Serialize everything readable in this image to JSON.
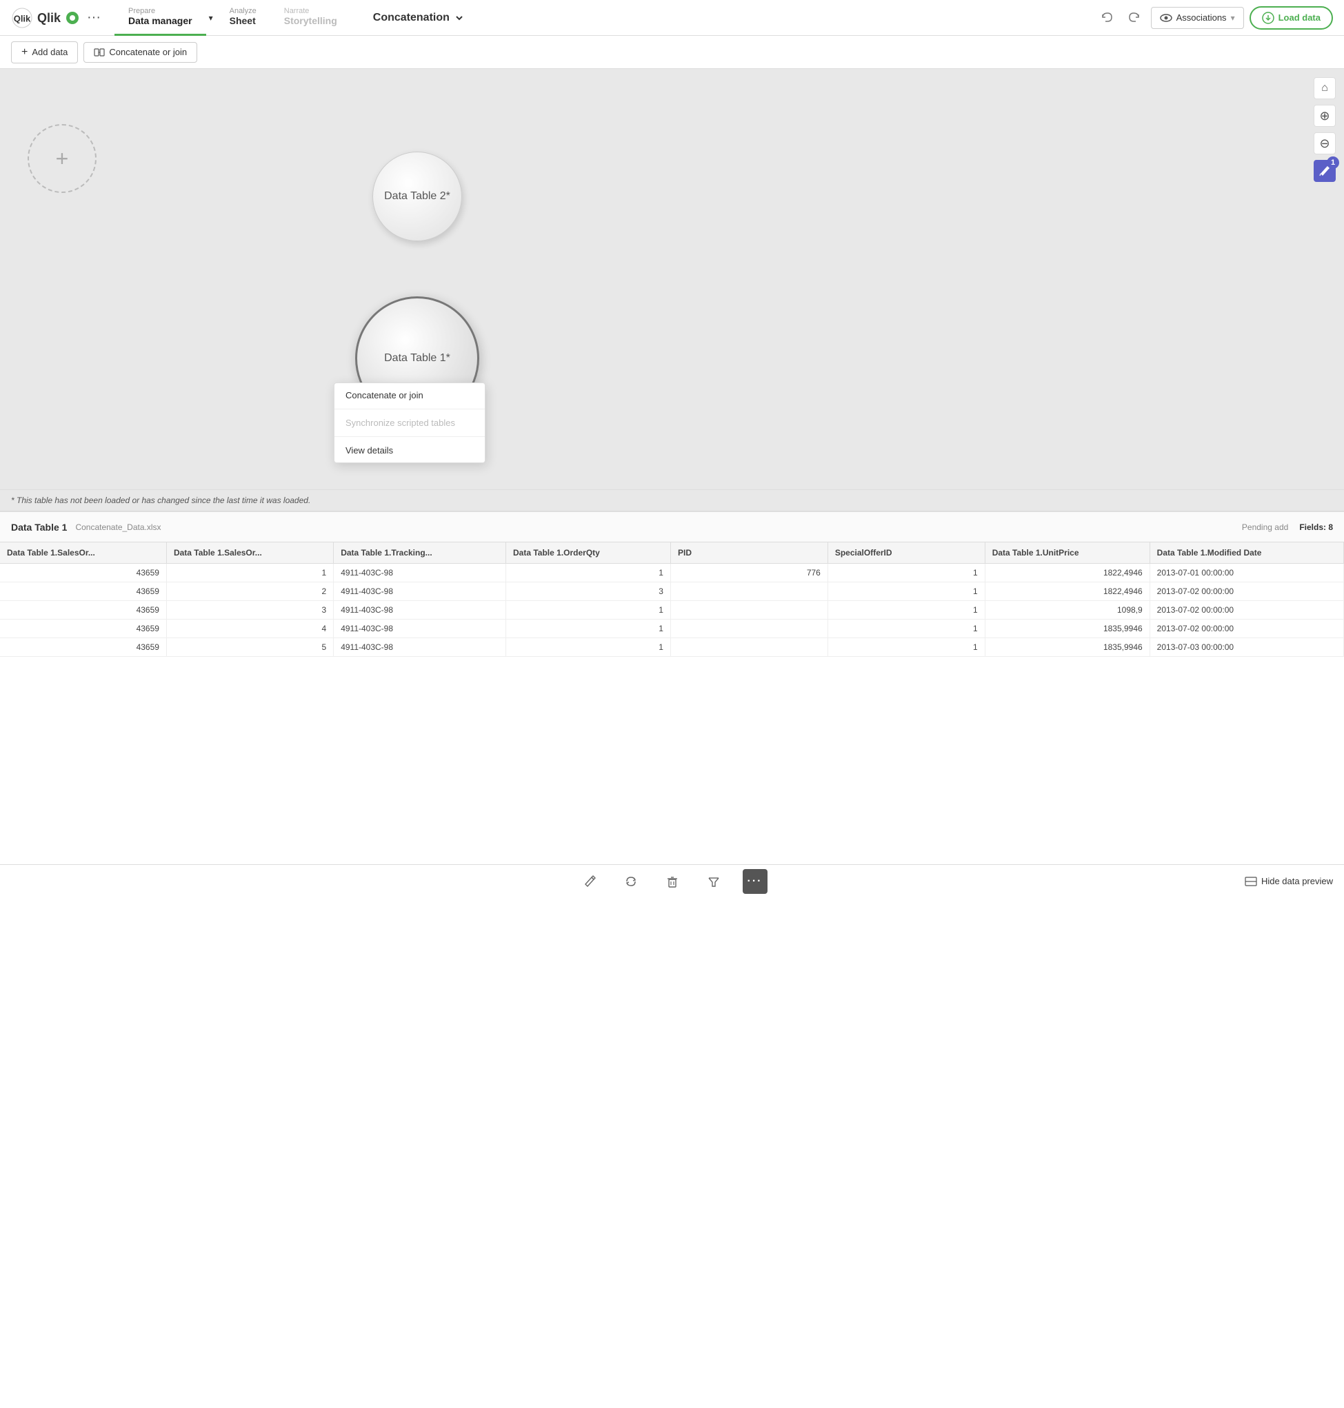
{
  "app": {
    "logo_text": "Qlik",
    "more_label": "···"
  },
  "nav": {
    "prepare_sub": "Prepare",
    "prepare_main": "Data manager",
    "analyze_sub": "Analyze",
    "analyze_main": "Sheet",
    "narrate_sub": "Narrate",
    "narrate_main": "Storytelling",
    "dropdown_label": "Concatenation",
    "associations_label": "Associations",
    "load_data_label": "Load data"
  },
  "toolbar": {
    "add_data_label": "Add data",
    "concatenate_join_label": "Concatenate or join"
  },
  "canvas": {
    "add_table_icon": "+",
    "table2_label": "Data Table 2*",
    "table1_label": "Data Table 1*",
    "footnote": "* This table has not been loaded or has changed since the last time it was loaded.",
    "badge_count": "1"
  },
  "controls": {
    "home_icon": "⌂",
    "zoom_in_icon": "⊕",
    "zoom_out_icon": "⊖",
    "pencil_icon": "✎"
  },
  "data_preview": {
    "title": "Data Table 1",
    "subtitle": "Concatenate_Data.xlsx",
    "pending_label": "Pending add",
    "fields_label": "Fields: 8"
  },
  "table": {
    "columns": [
      "Data Table 1.SalesOr...",
      "Data Table 1.SalesOr...",
      "Data Table 1.Tracking...",
      "Data Table 1.OrderQty",
      "PID",
      "SpecialOfferID",
      "Data Table 1.UnitPrice",
      "Data Table 1.Modified Date"
    ],
    "rows": [
      [
        "43659",
        "1",
        "4911-403C-98",
        "1",
        "776",
        "1",
        "1822,4946",
        "2013-07-01 00:00:00"
      ],
      [
        "43659",
        "2",
        "4911-403C-98",
        "3",
        "",
        "1",
        "1822,4946",
        "2013-07-02 00:00:00"
      ],
      [
        "43659",
        "3",
        "4911-403C-98",
        "1",
        "",
        "1",
        "1098,9",
        "2013-07-02 00:00:00"
      ],
      [
        "43659",
        "4",
        "4911-403C-98",
        "1",
        "",
        "1",
        "1835,9946",
        "2013-07-02 00:00:00"
      ],
      [
        "43659",
        "5",
        "4911-403C-98",
        "1",
        "",
        "1",
        "1835,9946",
        "2013-07-03 00:00:00"
      ]
    ]
  },
  "context_menu": {
    "concatenate_join": "Concatenate or join",
    "sync_scripted": "Synchronize scripted tables",
    "view_details": "View details"
  },
  "bottom_toolbar": {
    "edit_icon": "✎",
    "refresh_icon": "↻",
    "delete_icon": "🗑",
    "filter_icon": "⊞",
    "more_icon": "···",
    "hide_data_label": "Hide data preview"
  }
}
